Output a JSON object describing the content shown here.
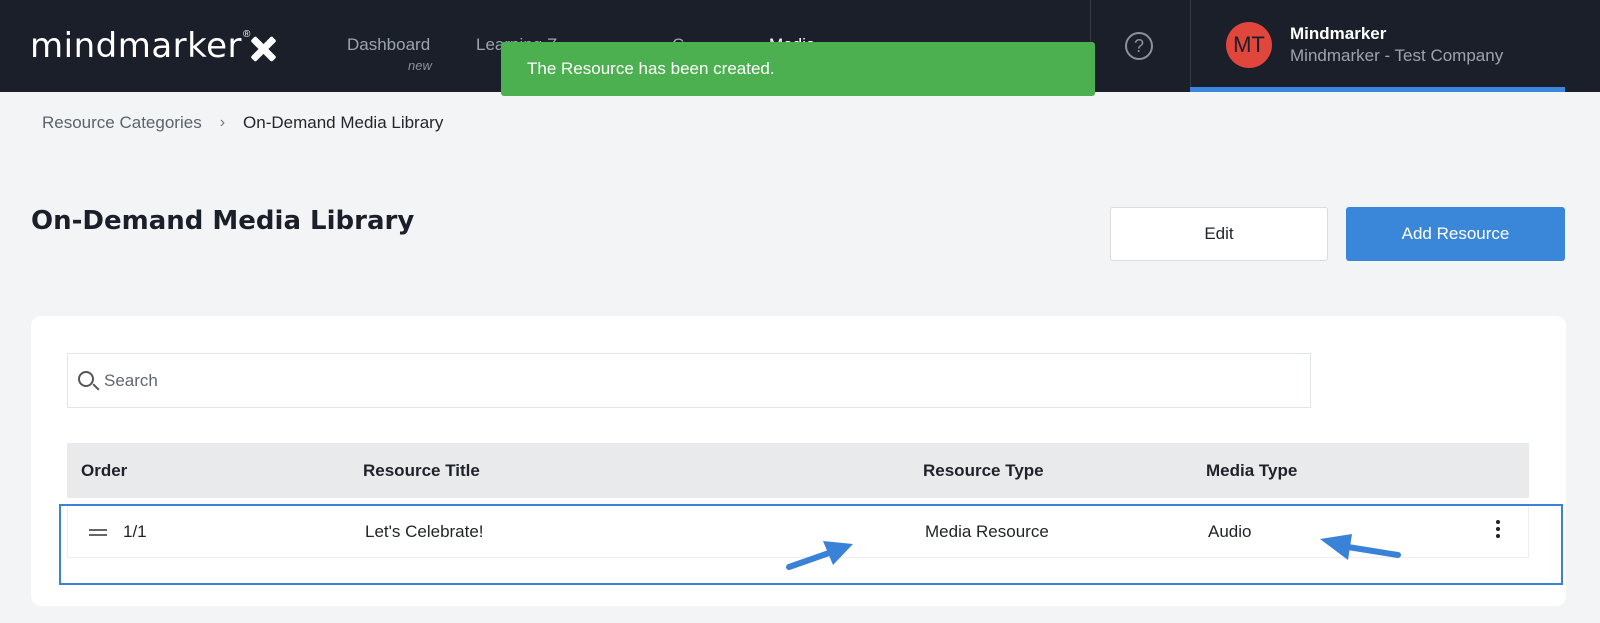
{
  "app": {
    "logo_text": "mindmarker",
    "logo_reg": "®"
  },
  "nav": {
    "items": [
      {
        "label": "Dashboard",
        "sub": "new"
      },
      {
        "label": "Learning Z"
      },
      {
        "label": "C"
      },
      {
        "label": "Media"
      }
    ]
  },
  "toast": {
    "message": "The Resource has been created."
  },
  "help": {
    "glyph": "?"
  },
  "user": {
    "initials": "MT",
    "name": "Mindmarker",
    "company": "Mindmarker - Test Company"
  },
  "breadcrumb": {
    "parent": "Resource Categories",
    "separator": "›",
    "current": "On-Demand Media Library"
  },
  "page": {
    "title": "On-Demand Media Library",
    "edit_label": "Edit",
    "add_label": "Add Resource"
  },
  "search": {
    "placeholder": "Search",
    "value": ""
  },
  "table": {
    "headers": {
      "order": "Order",
      "title": "Resource Title",
      "resource_type": "Resource Type",
      "media_type": "Media Type"
    },
    "rows": [
      {
        "order": "1/1",
        "title": "Let's Celebrate!",
        "resource_type": "Media Resource",
        "media_type": "Audio"
      }
    ]
  },
  "colors": {
    "topbar": "#1b1f2a",
    "accent": "#3a86d9",
    "toast": "#4caf50",
    "avatar": "#e0463c",
    "annotation": "#3a82d8"
  }
}
